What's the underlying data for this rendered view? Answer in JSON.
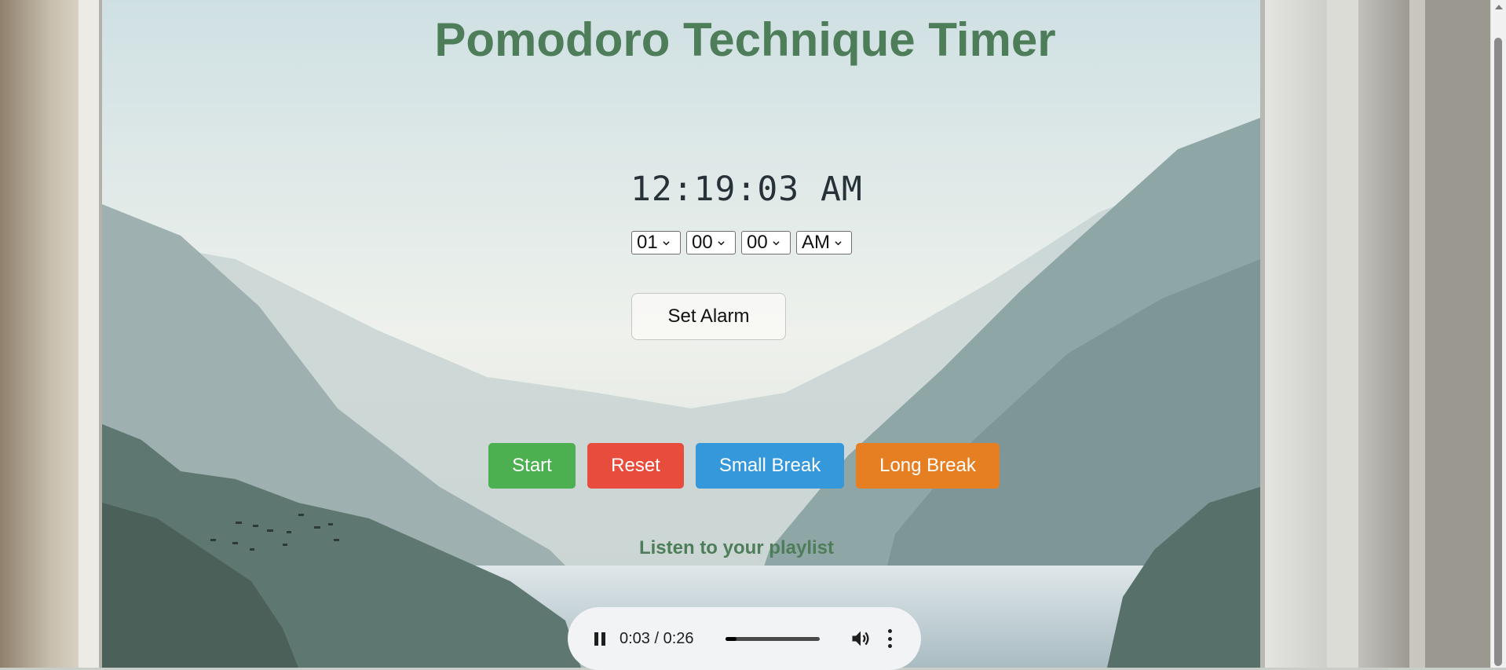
{
  "page": {
    "title": "Pomodoro Technique Timer",
    "clock": "12:19:03 AM",
    "alarm": {
      "hour": "01",
      "minute": "00",
      "second": "00",
      "ampm": "AM",
      "set_label": "Set Alarm"
    },
    "controls": {
      "start": "Start",
      "reset": "Reset",
      "small_break": "Small Break",
      "long_break": "Long Break"
    },
    "playlist_label": "Listen to your playlist",
    "audio": {
      "time": "0:03 / 0:26",
      "progress": 0.12,
      "icons": [
        "pause-icon",
        "volume-icon",
        "more-vert-icon"
      ]
    }
  },
  "colors": {
    "title": "#4e7d59",
    "start": "#4caf50",
    "reset": "#e74c3c",
    "small_break": "#3498db",
    "long_break": "#e67e22"
  }
}
